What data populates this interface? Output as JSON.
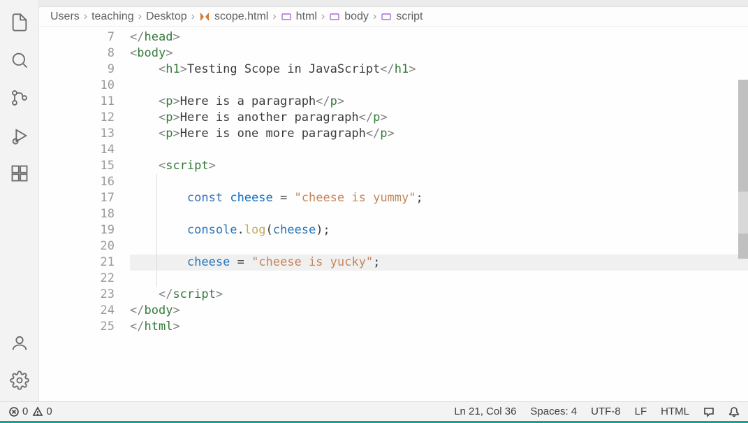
{
  "breadcrumb": {
    "items": [
      "Users",
      "teaching",
      "Desktop",
      "scope.html",
      "html",
      "body",
      "script"
    ]
  },
  "editor": {
    "startLine": 7,
    "currentLine": 21,
    "lines": {
      "7": {
        "html": "<span class='tag-bracket'>&lt;/</span><span class='tag-name'>head</span><span class='tag-bracket'>&gt;</span>",
        "indent": 0
      },
      "8": {
        "html": "<span class='tag-bracket'>&lt;</span><span class='tag-name'>body</span><span class='tag-bracket'>&gt;</span>",
        "indent": 0
      },
      "9": {
        "html": "<span class='tag-bracket'>&lt;</span><span class='tag-name'>h1</span><span class='tag-bracket'>&gt;</span>Testing Scope in JavaScript<span class='tag-bracket'>&lt;/</span><span class='tag-name'>h1</span><span class='tag-bracket'>&gt;</span>",
        "indent": 1
      },
      "10": {
        "html": "",
        "indent": 1
      },
      "11": {
        "html": "<span class='tag-bracket'>&lt;</span><span class='tag-name'>p</span><span class='tag-bracket'>&gt;</span>Here is a paragraph<span class='tag-bracket'>&lt;/</span><span class='tag-name'>p</span><span class='tag-bracket'>&gt;</span>",
        "indent": 1
      },
      "12": {
        "html": "<span class='tag-bracket'>&lt;</span><span class='tag-name'>p</span><span class='tag-bracket'>&gt;</span>Here is another paragraph<span class='tag-bracket'>&lt;/</span><span class='tag-name'>p</span><span class='tag-bracket'>&gt;</span>",
        "indent": 1
      },
      "13": {
        "html": "<span class='tag-bracket'>&lt;</span><span class='tag-name'>p</span><span class='tag-bracket'>&gt;</span>Here is one more paragraph<span class='tag-bracket'>&lt;/</span><span class='tag-name'>p</span><span class='tag-bracket'>&gt;</span>",
        "indent": 1
      },
      "14": {
        "html": "",
        "indent": 1
      },
      "15": {
        "html": "<span class='tag-bracket'>&lt;</span><span class='tag-name'>script</span><span class='tag-bracket'>&gt;</span>",
        "indent": 1
      },
      "16": {
        "html": "",
        "indent": 1
      },
      "17": {
        "html": "<span class='keyword'>const</span> <span class='var'>cheese</span> <span class='op'>=</span> <span class='str'>\"cheese is yummy\"</span>;",
        "indent": 2
      },
      "18": {
        "html": "",
        "indent": 1
      },
      "19": {
        "html": "<span class='obj'>console</span>.<span class='fn'>log</span>(<span class='obj'>cheese</span>);",
        "indent": 2
      },
      "20": {
        "html": "",
        "indent": 1
      },
      "21": {
        "html": "<span class='obj'>cheese</span> <span class='op'>=</span> <span class='str'>\"cheese is yucky\"</span>;",
        "indent": 2
      },
      "22": {
        "html": "",
        "indent": 1
      },
      "23": {
        "html": "<span class='tag-bracket'>&lt;/</span><span class='tag-name'>script</span><span class='tag-bracket'>&gt;</span>",
        "indent": 1
      },
      "24": {
        "html": "<span class='tag-bracket'>&lt;/</span><span class='tag-name'>body</span><span class='tag-bracket'>&gt;</span>",
        "indent": 0
      },
      "25": {
        "html": "<span class='tag-bracket'>&lt;/</span><span class='tag-name'>html</span><span class='tag-bracket'>&gt;</span>",
        "indent": 0
      }
    }
  },
  "status": {
    "errors": "0",
    "warnings": "0",
    "position": "Ln 21, Col 36",
    "spaces": "Spaces: 4",
    "encoding": "UTF-8",
    "eol": "LF",
    "language": "HTML"
  }
}
